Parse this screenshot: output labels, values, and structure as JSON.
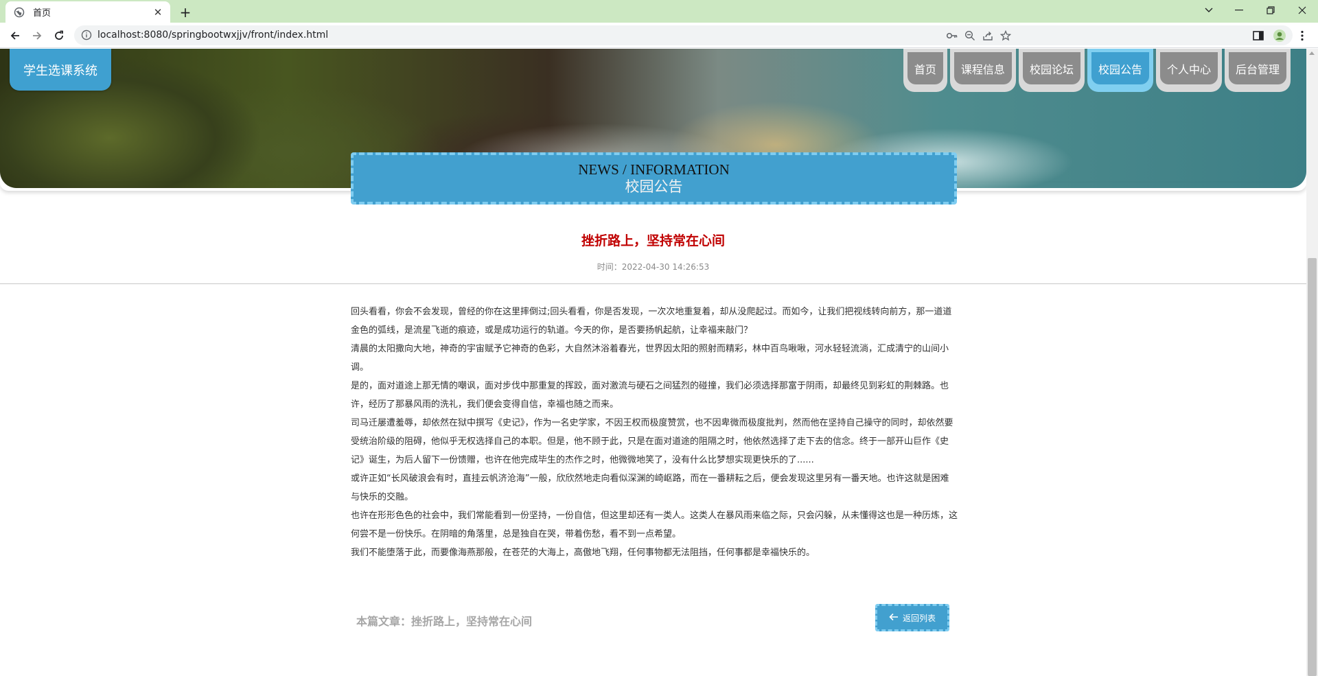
{
  "browser": {
    "tab_title": "首页",
    "url": "localhost:8080/springbootwxjjv/front/index.html"
  },
  "site": {
    "logo": "学生选课系统",
    "nav": [
      {
        "label": "首页",
        "active": false
      },
      {
        "label": "课程信息",
        "active": false
      },
      {
        "label": "校园论坛",
        "active": false
      },
      {
        "label": "校园公告",
        "active": true
      },
      {
        "label": "个人中心",
        "active": false
      },
      {
        "label": "后台管理",
        "active": false
      }
    ]
  },
  "section": {
    "title_en": "NEWS / INFORMATION",
    "title_cn": "校园公告"
  },
  "article": {
    "title": "挫折路上，坚持常在心间",
    "time": "时间：2022-04-30 14:26:53",
    "paragraphs": [
      "回头看看，你会不会发现，曾经的你在这里摔倒过;回头看看，你是否发现，一次次地重复着，却从没爬起过。而如今，让我们把视线转向前方，那一道道金色的弧线，是流星飞逝的痕迹，或是成功运行的轨道。今天的你，是否要扬帆起航，让幸福来敲门？",
      "清晨的太阳撒向大地，神奇的宇宙赋予它神奇的色彩，大自然沐浴着春光，世界因太阳的照射而精彩，林中百鸟啾啾，河水轻轻流淌，汇成清宁的山间小调。",
      "是的，面对道途上那无情的嘲讽，面对步伐中那重复的挥跤，面对激流与硬石之间猛烈的碰撞，我们必须选择那富于阴雨，却最终见到彩虹的荆棘路。也许，经历了那暴风雨的洗礼，我们便会变得自信，幸福也随之而来。",
      "司马迁屡遭羞辱，却依然在狱中撰写《史记》，作为一名史学家，不因王权而极度赞赏，也不因卑微而极度批判，然而他在坚持自己操守的同时，却依然要受统治阶级的阻碍，他似乎无权选择自己的本职。但是，他不顾于此，只是在面对道途的阻隔之时，他依然选择了走下去的信念。终于一部开山巨作《史记》诞生，为后人留下一份馈赠，也许在他完成毕生的杰作之时，他微微地笑了，没有什么比梦想实现更快乐的了......",
      "或许正如“长风破浪会有时，直挂云帆济沧海”一般，欣欣然地走向看似深渊的崎岖路，而在一番耕耘之后，便会发现这里另有一番天地。也许这就是困难与快乐的交融。",
      "也许在形形色色的社会中，我们常能看到一份坚持，一份自信，但这里却还有一类人。这类人在暴风雨来临之际，只会闪躲，从未懂得这也是一种历炼，这何尝不是一份快乐。在阴暗的角落里，总是独自在哭，带着伤愁，看不到一点希望。",
      "我们不能堕落于此，而要像海燕那般，在苍茫的大海上，高傲地飞翔，任何事物都无法阻挡，任何事都是幸福快乐的。"
    ],
    "footer_label": "本篇文章：挫折路上，坚持常在心间",
    "back_button": "返回列表"
  },
  "colors": {
    "accent": "#42a0cf",
    "accent_light": "#7fcdf1",
    "title_red": "#c00000",
    "tab_strip": "#cce8c2"
  },
  "icons": [
    "globe-icon",
    "close-icon",
    "plus-icon",
    "back-arrow-icon",
    "forward-arrow-icon",
    "reload-icon",
    "info-icon",
    "key-icon",
    "zoom-icon",
    "share-icon",
    "star-icon",
    "sidebar-icon",
    "profile-icon",
    "kebab-menu-icon",
    "arrow-left-icon"
  ]
}
